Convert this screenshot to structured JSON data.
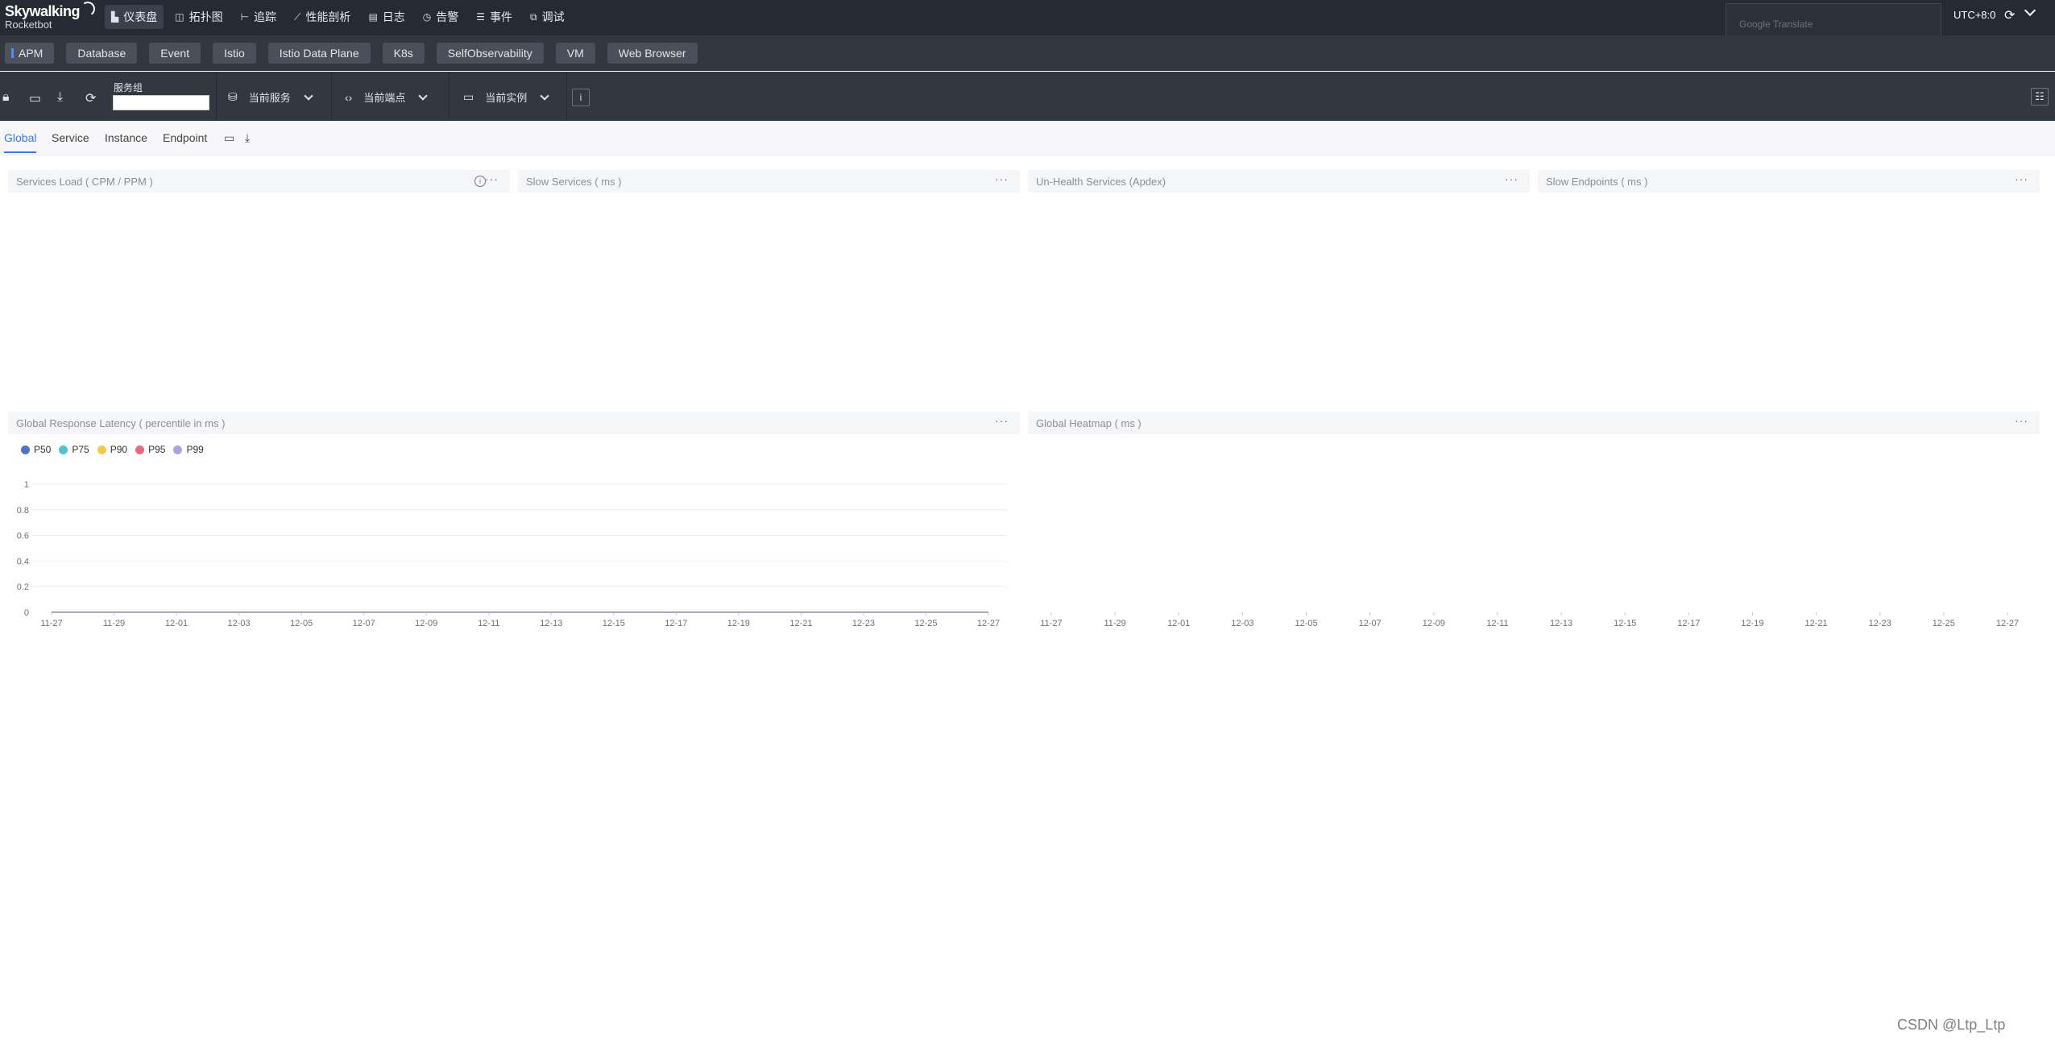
{
  "app": {
    "logo_line1": "Skywalking",
    "logo_line2": "Rocketbot"
  },
  "topnav": {
    "items": [
      {
        "label": "仪表盘",
        "icon": "dashboard-icon",
        "active": true
      },
      {
        "label": "拓扑图",
        "icon": "topology-icon",
        "active": false
      },
      {
        "label": "追踪",
        "icon": "trace-icon",
        "active": false
      },
      {
        "label": "性能剖析",
        "icon": "profile-icon",
        "active": false
      },
      {
        "label": "日志",
        "icon": "log-icon",
        "active": false
      },
      {
        "label": "告警",
        "icon": "alarm-icon",
        "active": false
      },
      {
        "label": "事件",
        "icon": "event-icon",
        "active": false
      },
      {
        "label": "调试",
        "icon": "debug-icon",
        "active": false
      }
    ],
    "translate_label": "Google Translate",
    "timezone": "UTC+8:0"
  },
  "layers": {
    "items": [
      "APM",
      "Database",
      "Event",
      "Istio",
      "Istio Data Plane",
      "K8s",
      "SelfObservability",
      "VM",
      "Web Browser"
    ],
    "active": "APM"
  },
  "toolbar": {
    "group_label": "服务组",
    "group_value": "",
    "current_service": "当前服务",
    "current_endpoint": "当前端点",
    "current_instance": "当前实例"
  },
  "subtabs": {
    "items": [
      "Global",
      "Service",
      "Instance",
      "Endpoint"
    ],
    "active": "Global"
  },
  "widgets": {
    "services_load": "Services Load ( CPM / PPM )",
    "slow_services": "Slow Services ( ms )",
    "unhealth_services": "Un-Health Services (Apdex)",
    "slow_endpoints": "Slow Endpoints ( ms )",
    "global_latency": "Global Response Latency ( percentile in ms )",
    "global_heatmap": "Global Heatmap ( ms )"
  },
  "chart_data": [
    {
      "type": "line",
      "title": "Global Response Latency ( percentile in ms )",
      "categories": [
        "11-27",
        "11-29",
        "12-01",
        "12-03",
        "12-05",
        "12-07",
        "12-09",
        "12-11",
        "12-13",
        "12-15",
        "12-17",
        "12-19",
        "12-21",
        "12-23",
        "12-25",
        "12-27"
      ],
      "series": [
        {
          "name": "P50",
          "values": [
            0,
            0,
            0,
            0,
            0,
            0,
            0,
            0,
            0,
            0,
            0,
            0,
            0,
            0,
            0,
            0
          ],
          "color": "#5470c6"
        },
        {
          "name": "P75",
          "values": [
            0,
            0,
            0,
            0,
            0,
            0,
            0,
            0,
            0,
            0,
            0,
            0,
            0,
            0,
            0,
            0
          ],
          "color": "#4fc3cf"
        },
        {
          "name": "P90",
          "values": [
            0,
            0,
            0,
            0,
            0,
            0,
            0,
            0,
            0,
            0,
            0,
            0,
            0,
            0,
            0,
            0
          ],
          "color": "#f7c948"
        },
        {
          "name": "P95",
          "values": [
            0,
            0,
            0,
            0,
            0,
            0,
            0,
            0,
            0,
            0,
            0,
            0,
            0,
            0,
            0,
            0
          ],
          "color": "#e8697c"
        },
        {
          "name": "P99",
          "values": [
            0,
            0,
            0,
            0,
            0,
            0,
            0,
            0,
            0,
            0,
            0,
            0,
            0,
            0,
            0,
            0
          ],
          "color": "#a8a4e6"
        }
      ],
      "y_ticks": [
        "0",
        "0.2",
        "0.4",
        "0.6",
        "0.8",
        "1"
      ],
      "ylim": [
        0,
        1
      ],
      "grid": true,
      "legend": "top-left"
    },
    {
      "type": "heatmap",
      "title": "Global Heatmap ( ms )",
      "categories": [
        "11-27",
        "11-29",
        "12-01",
        "12-03",
        "12-05",
        "12-07",
        "12-09",
        "12-11",
        "12-13",
        "12-15",
        "12-17",
        "12-19",
        "12-21",
        "12-23",
        "12-25",
        "12-27"
      ],
      "values": []
    }
  ],
  "watermark": "CSDN @Ltp_Ltp"
}
